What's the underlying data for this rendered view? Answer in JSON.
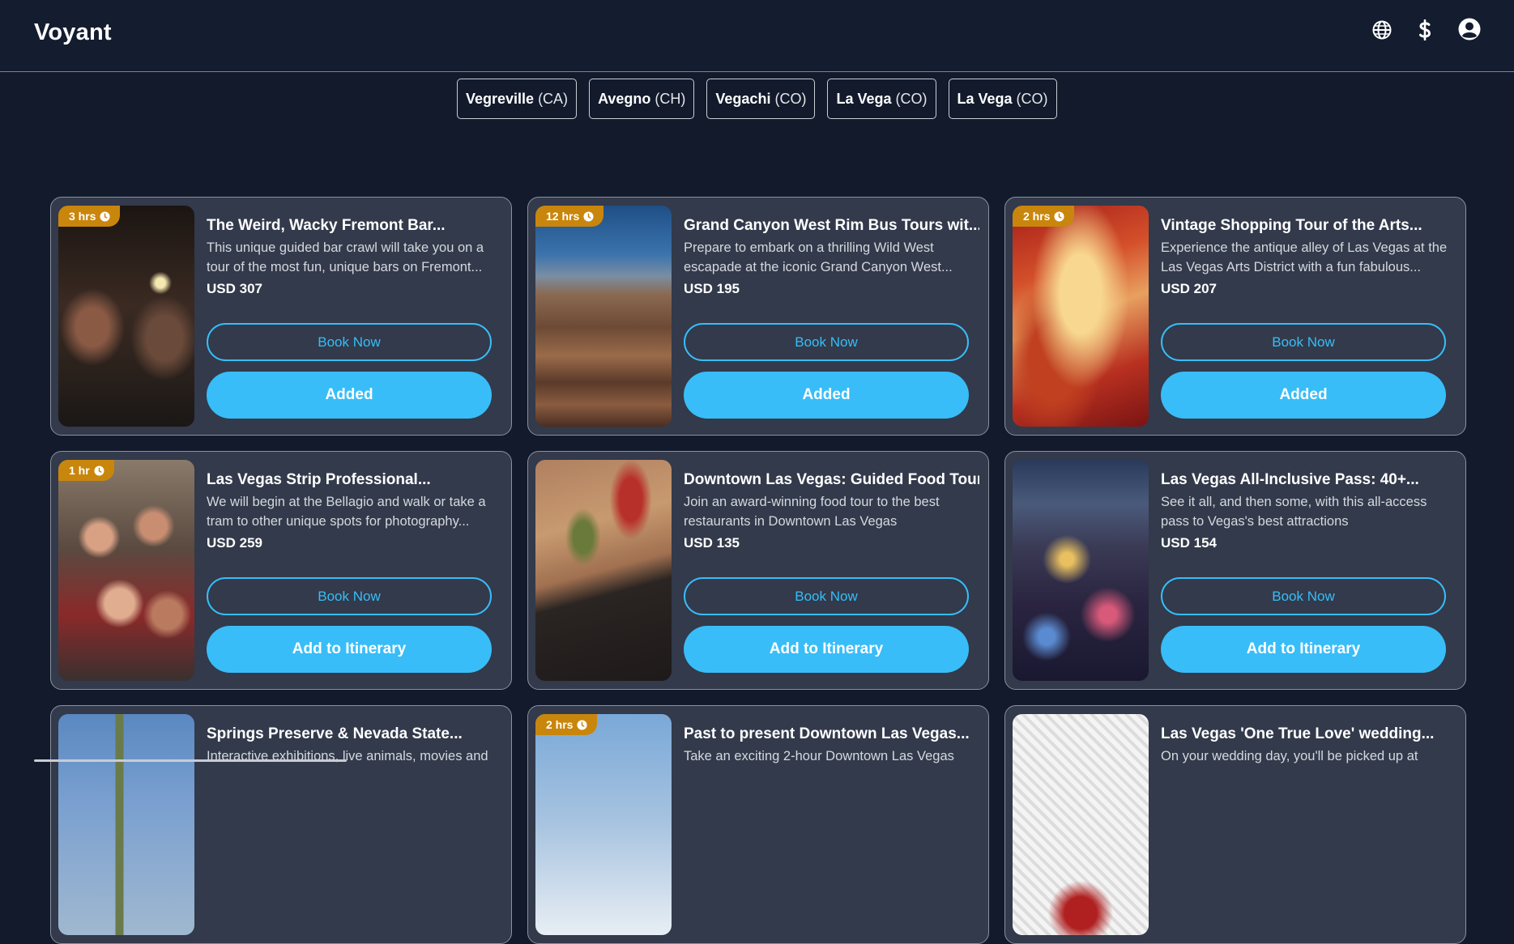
{
  "app": {
    "logo": "Voyant"
  },
  "header_icons": [
    "globe-icon",
    "dollar-icon",
    "user-icon"
  ],
  "locations": [
    {
      "name": "Vegreville",
      "code": "(CA)"
    },
    {
      "name": "Avegno",
      "code": "(CH)"
    },
    {
      "name": "Vegachi",
      "code": "(CO)"
    },
    {
      "name": "La Vega",
      "code": "(CO)"
    },
    {
      "name": "La Vega",
      "code": "(CO)"
    }
  ],
  "book_label": "Book Now",
  "tours": [
    {
      "duration": "3 hrs",
      "title": "The Weird, Wacky Fremont Bar...",
      "description": "This unique guided bar crawl will take you on a tour of the most fun, unique bars on Fremont...",
      "price": "USD 307",
      "action": "Added",
      "image": "bar-crawl-photo"
    },
    {
      "duration": "12 hrs",
      "title": "Grand Canyon West Rim Bus Tours wit...",
      "description": "Prepare to embark on a thrilling Wild West escapade at the iconic Grand Canyon West...",
      "price": "USD 195",
      "action": "Added",
      "image": "grand-canyon-photo"
    },
    {
      "duration": "2 hrs",
      "title": "Vintage Shopping Tour of the Arts...",
      "description": "Experience the antique alley of Las Vegas at the Las Vegas Arts District with a fun fabulous...",
      "price": "USD 207",
      "action": "Added",
      "image": "champagne-toast-photo"
    },
    {
      "duration": "1 hr",
      "title": "Las Vegas Strip Professional...",
      "description": "We will begin at the Bellagio and walk or take a tram to other unique spots for photography...",
      "price": "USD 259",
      "action": "Add to Itinerary",
      "image": "group-selfie-photo"
    },
    {
      "duration": "",
      "title": "Downtown Las Vegas: Guided Food Tour",
      "description": "Join an award-winning food tour to the best restaurants in Downtown Las Vegas",
      "price": "USD 135",
      "action": "Add to Itinerary",
      "image": "food-platter-photo"
    },
    {
      "duration": "",
      "title": "Las Vegas All-Inclusive Pass: 40+...",
      "description": "See it all, and then some, with this all-access pass to Vegas's best attractions",
      "price": "USD 154",
      "action": "Add to Itinerary",
      "image": "vegas-night-photo"
    },
    {
      "duration": "",
      "title": "Springs Preserve & Nevada State...",
      "description": "Interactive exhibitions, live animals, movies and",
      "price": "",
      "action": "",
      "image": "cactus-sky-photo"
    },
    {
      "duration": "2 hrs",
      "title": "Past to present Downtown Las Vegas...",
      "description": "Take an exciting 2-hour Downtown Las Vegas",
      "price": "",
      "action": "",
      "image": "downtown-sign-photo"
    },
    {
      "duration": "",
      "title": "Las Vegas 'One True Love' wedding...",
      "description": "On your wedding day, you'll be picked up at",
      "price": "",
      "action": "",
      "image": "wedding-flowers-photo"
    }
  ]
}
